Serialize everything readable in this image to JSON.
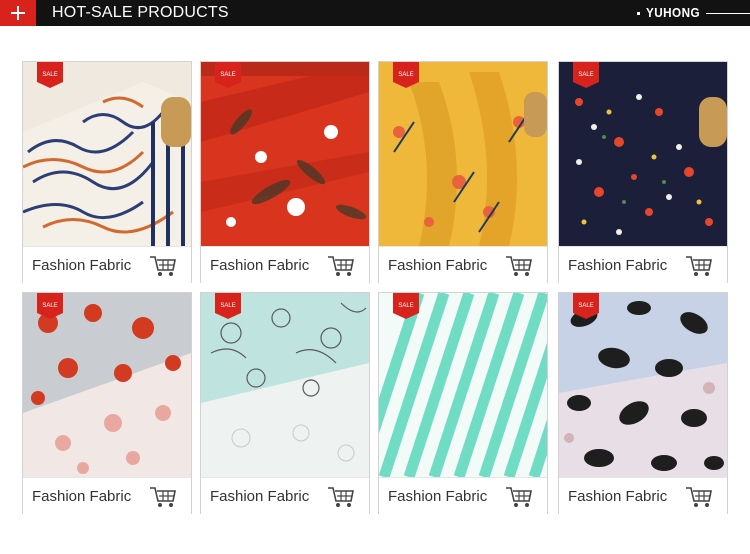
{
  "header": {
    "title": "HOT-SALE PRODUCTS",
    "brand": "YUHONG",
    "accent_color": "#d8231d",
    "bar_color": "#121212",
    "icon": "plus-icon"
  },
  "products": [
    {
      "badge": "SALE",
      "name": "Fashion Fabric",
      "cart_icon": "shopping-cart-icon",
      "pattern": "geometric-stripes"
    },
    {
      "badge": "SALE",
      "name": "Fashion Fabric",
      "cart_icon": "shopping-cart-icon",
      "pattern": "red-floral"
    },
    {
      "badge": "SALE",
      "name": "Fashion Fabric",
      "cart_icon": "shopping-cart-icon",
      "pattern": "yellow-floral"
    },
    {
      "badge": "SALE",
      "name": "Fashion Fabric",
      "cart_icon": "shopping-cart-icon",
      "pattern": "navy-floral"
    },
    {
      "badge": "SALE",
      "name": "Fashion Fabric",
      "cart_icon": "shopping-cart-icon",
      "pattern": "red-roses-on-grey"
    },
    {
      "badge": "SALE",
      "name": "Fashion Fabric",
      "cart_icon": "shopping-cart-icon",
      "pattern": "mint-line-floral"
    },
    {
      "badge": "SALE",
      "name": "Fashion Fabric",
      "cart_icon": "shopping-cart-icon",
      "pattern": "mint-stripes"
    },
    {
      "badge": "SALE",
      "name": "Fashion Fabric",
      "cart_icon": "shopping-cart-icon",
      "pattern": "leopard-print"
    }
  ]
}
